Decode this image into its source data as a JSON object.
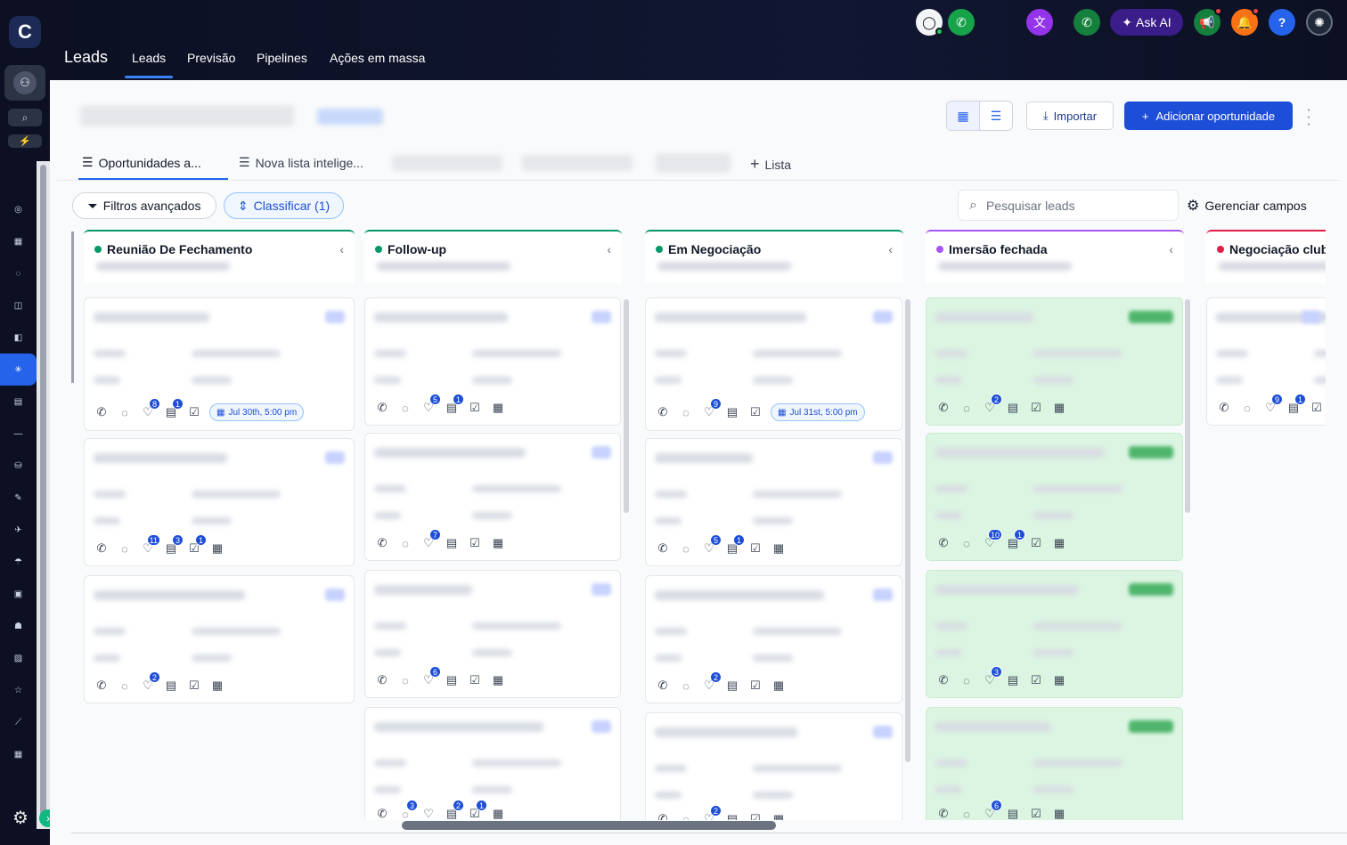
{
  "app": {
    "logo": "C"
  },
  "sidebar": {
    "avatar_initial": "⚇",
    "search_icon": "⌕",
    "bolt_icon": "⚡",
    "items": [
      "◎",
      "▦",
      "◌",
      "◫",
      "◧",
      "✳",
      "▤",
      "—",
      "⛁",
      "✎",
      "✈",
      "☂",
      "▣",
      "☗",
      "▨",
      "☆",
      "⟋",
      "▦"
    ],
    "active_index": 5
  },
  "topbar": {
    "title": "Leads",
    "tabs": [
      "Leads",
      "Previsão",
      "Pipelines",
      "Ações em massa"
    ],
    "active_tab": "Leads",
    "ask_ai": "Ask AI",
    "help": "?"
  },
  "toolbar": {
    "import_label": "Importar",
    "add_label": "Adicionar oportunidade"
  },
  "list_tabs": [
    {
      "label": "Oportunidades a..."
    },
    {
      "label": "Nova lista intelige..."
    }
  ],
  "add_list_label": "Lista",
  "filters": {
    "advanced_label": "Filtros avançados",
    "sort_label": "Classificar (1)",
    "search_placeholder": "Pesquisar leads",
    "manage_fields_label": "Gerenciar campos"
  },
  "colors": {
    "primary": "#1d4ed8",
    "stage_green": "#059669",
    "stage_purple": "#a855f7",
    "stage_pink": "#e11d48",
    "won_card": "#dcf5e2"
  },
  "columns": [
    {
      "name": "Reunião De Fechamento",
      "dot": "#059669",
      "cards": [
        {
          "badges": {
            "tag": "8",
            "doc": "1"
          },
          "date": "Jul 30th, 5:00 pm"
        },
        {
          "badges": {
            "tag": "11",
            "doc": "3",
            "check": "1"
          }
        },
        {
          "badges": {
            "tag": "2"
          }
        }
      ]
    },
    {
      "name": "Follow-up",
      "dot": "#059669",
      "cards": [
        {
          "badges": {
            "tag": "5",
            "doc": "1"
          }
        },
        {
          "badges": {
            "tag": "7"
          }
        },
        {
          "badges": {
            "tag": "6"
          }
        },
        {
          "badges": {
            "chat": "3",
            "doc": "2",
            "check": "1"
          }
        }
      ]
    },
    {
      "name": "Em Negociação",
      "dot": "#059669",
      "cards": [
        {
          "badges": {
            "tag": "9"
          },
          "date": "Jul 31st, 5:00 pm"
        },
        {
          "badges": {
            "tag": "5",
            "doc": "1"
          }
        },
        {
          "badges": {
            "tag": "2"
          }
        },
        {
          "badges": {
            "tag": "2"
          }
        }
      ]
    },
    {
      "name": "Imersão fechada",
      "dot": "#a855f7",
      "cards": [
        {
          "badges": {
            "tag": "2"
          }
        },
        {
          "badges": {
            "tag": "10",
            "doc": "1"
          }
        },
        {
          "badges": {
            "tag": "3"
          }
        },
        {
          "badges": {
            "tag": "6"
          }
        }
      ]
    },
    {
      "name": "Negociação club",
      "dot": "#e11d48",
      "cards": [
        {
          "badges": {
            "tag": "9",
            "doc": "1"
          }
        }
      ]
    }
  ]
}
